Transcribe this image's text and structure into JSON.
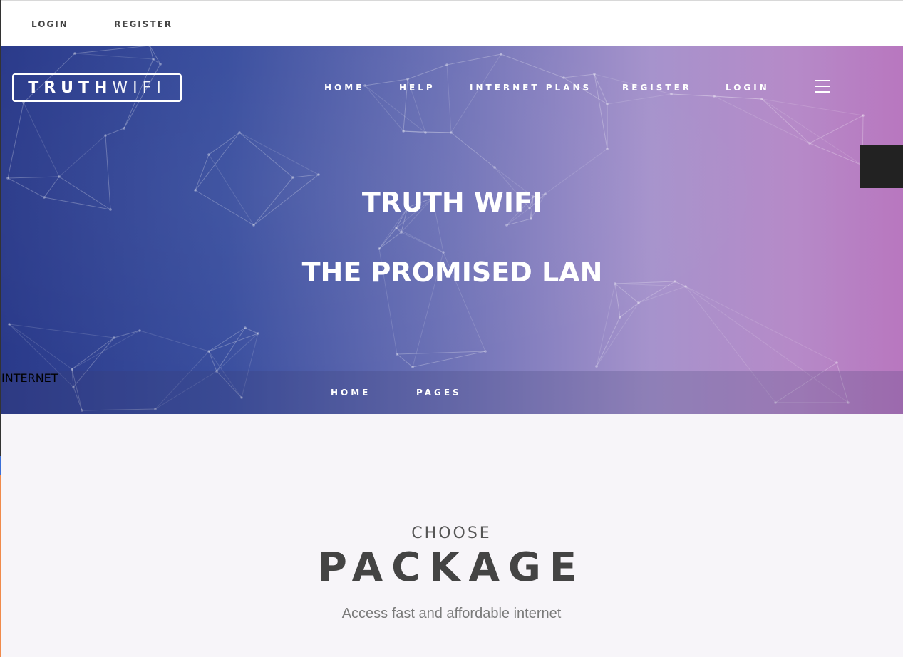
{
  "topbar": {
    "login": "LOGIN",
    "register": "REGISTER"
  },
  "logo": {
    "part1": "TRUTH",
    "part2": "WIFI"
  },
  "nav": {
    "home": "HOME",
    "help": "HELP",
    "plans": "INTERNET PLANS",
    "register": "REGISTER",
    "login": "LOGIN"
  },
  "hero": {
    "title": "TRUTH WIFI",
    "subtitle": "THE PROMISED LAN"
  },
  "breadcrumb": {
    "home": "HOME",
    "pages": "PAGES",
    "current": "INTERNET"
  },
  "package": {
    "kicker": "CHOOSE",
    "title": "PACKAGE",
    "subtitle": "Access fast and affordable internet"
  },
  "icons": {
    "menu": "hamburger-menu-icon"
  },
  "colors": {
    "hero_start": "#2a3a8a",
    "hero_end": "#b877bf",
    "side_tab": "#222222"
  }
}
